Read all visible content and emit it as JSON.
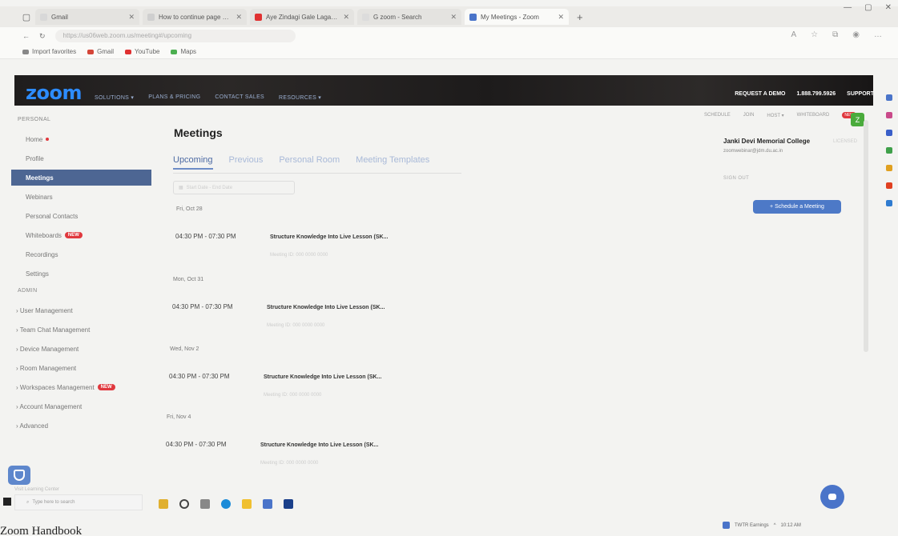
{
  "browser": {
    "tabs": [
      {
        "label": "Gmail",
        "color": "#d8d8d8"
      },
      {
        "label": "How to continue page numbers...",
        "color": "#cfcfcf"
      },
      {
        "label": "Aye Zindagi Gale Lagaa Le - Yo...",
        "color": "#e03131"
      },
      {
        "label": "G  zoom - Search",
        "color": "#dcdcdc"
      },
      {
        "label": "My Meetings - Zoom",
        "color": "#4a74c9"
      }
    ],
    "new_tab": "+",
    "url": "https://us06web.zoom.us/meeting#/upcoming",
    "bookmarks": [
      {
        "label": "Import favorites",
        "color": "#888888"
      },
      {
        "label": "Gmail",
        "color": "#d44638"
      },
      {
        "label": "YouTube",
        "color": "#e03131"
      },
      {
        "label": "Maps",
        "color": "#4caf50"
      }
    ]
  },
  "header": {
    "logo": "zoom",
    "nav": [
      "SOLUTIONS ▾",
      "PLANS & PRICING",
      "CONTACT SALES",
      "RESOURCES ▾"
    ],
    "right": [
      "REQUEST A DEMO",
      "1.888.799.5926",
      "SUPPORT"
    ],
    "subnav": [
      "SCHEDULE",
      "JOIN",
      "HOST ▾",
      "WHITEBOARD"
    ],
    "subnav_badge": "NEW",
    "avatar_letter": "Z"
  },
  "sidebar": {
    "personal_head": "PERSONAL",
    "personal": [
      {
        "label": "Home",
        "dot": true
      },
      {
        "label": "Profile"
      },
      {
        "label": "Meetings",
        "active": true
      },
      {
        "label": "Webinars"
      },
      {
        "label": "Personal Contacts"
      },
      {
        "label": "Whiteboards",
        "badge": "NEW"
      },
      {
        "label": "Recordings"
      },
      {
        "label": "Settings"
      }
    ],
    "admin_head": "ADMIN",
    "admin": [
      {
        "label": "› User Management"
      },
      {
        "label": "› Team Chat Management"
      },
      {
        "label": "› Device Management"
      },
      {
        "label": "› Room Management"
      },
      {
        "label": "› Workspaces Management",
        "badge": "NEW"
      },
      {
        "label": "› Account Management"
      },
      {
        "label": "› Advanced"
      }
    ],
    "help": "Visit Learning Center"
  },
  "main": {
    "title": "Meetings",
    "tabs": [
      "Upcoming",
      "Previous",
      "Personal Room",
      "Meeting Templates"
    ],
    "date_range": "Start Date  -  End Date",
    "meetings": [
      {
        "date": "Fri, Oct 28",
        "time": "04:30 PM - 07:30 PM",
        "topic": "Structure Knowledge Into Live Lesson (SK...",
        "id": "Meeting ID: 000 0000 0000"
      },
      {
        "date": "Mon, Oct 31",
        "time": "04:30 PM - 07:30 PM",
        "topic": "Structure Knowledge Into Live Lesson (SK...",
        "id": "Meeting ID: 000 0000 0000"
      },
      {
        "date": "Wed, Nov 2",
        "time": "04:30 PM - 07:30 PM",
        "topic": "Structure Knowledge Into Live Lesson (SK...",
        "id": "Meeting ID: 000 0000 0000"
      },
      {
        "date": "Fri, Nov 4",
        "time": "04:30 PM - 07:30 PM",
        "topic": "Structure Knowledge Into Live Lesson (SK...",
        "id": "Meeting ID: 000 0000 0000"
      }
    ]
  },
  "right_panel": {
    "org": "Janki Devi Memorial College",
    "org_badge": "LICENSED",
    "email": "zoomwebinar@jdm.du.ac.in",
    "sign_out": "SIGN OUT",
    "schedule_button": "+  Schedule a Meeting"
  },
  "taskbar": {
    "search": "Type here to search",
    "weather": "TWTR Earnings",
    "time": "10:12 AM"
  },
  "caption": "Zoom Handbook"
}
